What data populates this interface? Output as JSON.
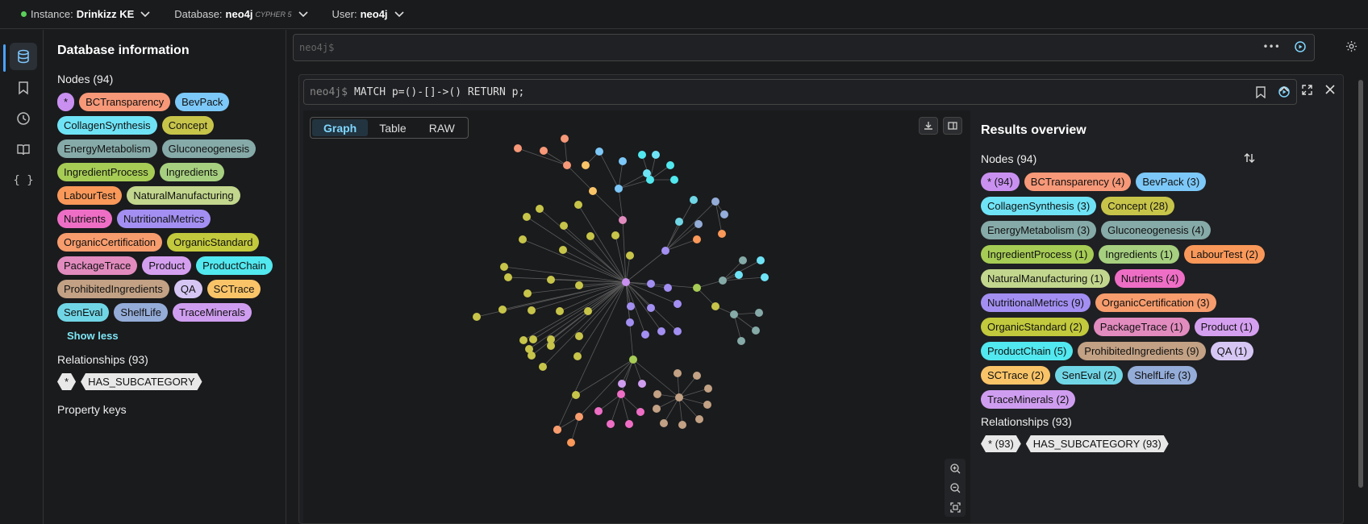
{
  "topbar": {
    "instance_label": "Instance:",
    "instance_value": "Drinkizz KE",
    "database_label": "Database:",
    "database_value": "neo4j",
    "database_tag": "CYPHER 5",
    "user_label": "User:",
    "user_value": "neo4j"
  },
  "sidebar": {
    "title": "Database information",
    "nodes_heading": "Nodes (94)",
    "show_less": "Show less",
    "relationships_heading": "Relationships (93)",
    "property_keys_heading": "Property keys",
    "labels": [
      {
        "text": "*",
        "color": "#c990f0"
      },
      {
        "text": "BCTransparency",
        "color": "#f79878"
      },
      {
        "text": "BevPack",
        "color": "#7cc8f8"
      },
      {
        "text": "CollagenSynthesis",
        "color": "#6fe3f6"
      },
      {
        "text": "Concept",
        "color": "#c7c44a"
      },
      {
        "text": "EnergyMetabolism",
        "color": "#85aaa8"
      },
      {
        "text": "Gluconeogenesis",
        "color": "#85aaa8"
      },
      {
        "text": "IngredientProcess",
        "color": "#a6cc55"
      },
      {
        "text": "Ingredients",
        "color": "#a6d07f"
      },
      {
        "text": "LabourTest",
        "color": "#f99859"
      },
      {
        "text": "NaturalManufacturing",
        "color": "#c2d68d"
      },
      {
        "text": "Nutrients",
        "color": "#ee6ec5"
      },
      {
        "text": "NutritionalMetrics",
        "color": "#a38ff2"
      },
      {
        "text": "OrganicCertification",
        "color": "#f79c6d"
      },
      {
        "text": "OrganicStandard",
        "color": "#c2c93c"
      },
      {
        "text": "PackageTrace",
        "color": "#e28bbf"
      },
      {
        "text": "Product",
        "color": "#d59ff0"
      },
      {
        "text": "ProductChain",
        "color": "#52e8ef"
      },
      {
        "text": "ProhibitedIngredients",
        "color": "#c2a184"
      },
      {
        "text": "QA",
        "color": "#d6c6f4"
      },
      {
        "text": "SCTrace",
        "color": "#f9c468"
      },
      {
        "text": "SenEval",
        "color": "#70d6e6"
      },
      {
        "text": "ShelfLife",
        "color": "#94acd8"
      },
      {
        "text": "TraceMinerals",
        "color": "#cf9df0"
      }
    ],
    "relationships": [
      "*",
      "HAS_SUBCATEGORY"
    ]
  },
  "editor": {
    "prompt": "neo4j$"
  },
  "frame": {
    "prompt": "neo4j$",
    "query": "MATCH p=()-[]->() RETURN p;"
  },
  "viz_tabs": [
    "Graph",
    "Table",
    "RAW"
  ],
  "results": {
    "title": "Results overview",
    "nodes_heading": "Nodes (94)",
    "relationships_heading": "Relationships (93)",
    "labels": [
      {
        "text": "* (94)",
        "color": "#c990f0"
      },
      {
        "text": "BCTransparency (4)",
        "color": "#f79878"
      },
      {
        "text": "BevPack (3)",
        "color": "#7cc8f8"
      },
      {
        "text": "CollagenSynthesis (3)",
        "color": "#6fe3f6"
      },
      {
        "text": "Concept (28)",
        "color": "#c7c44a"
      },
      {
        "text": "EnergyMetabolism (3)",
        "color": "#85aaa8"
      },
      {
        "text": "Gluconeogenesis (4)",
        "color": "#85aaa8"
      },
      {
        "text": "IngredientProcess (1)",
        "color": "#a6cc55"
      },
      {
        "text": "Ingredients (1)",
        "color": "#a6d07f"
      },
      {
        "text": "LabourTest (2)",
        "color": "#f99859"
      },
      {
        "text": "NaturalManufacturing (1)",
        "color": "#c2d68d"
      },
      {
        "text": "Nutrients (4)",
        "color": "#ee6ec5"
      },
      {
        "text": "NutritionalMetrics (9)",
        "color": "#a38ff2"
      },
      {
        "text": "OrganicCertification (3)",
        "color": "#f79c6d"
      },
      {
        "text": "OrganicStandard (2)",
        "color": "#c2c93c"
      },
      {
        "text": "PackageTrace (1)",
        "color": "#e28bbf"
      },
      {
        "text": "Product (1)",
        "color": "#d59ff0"
      },
      {
        "text": "ProductChain (5)",
        "color": "#52e8ef"
      },
      {
        "text": "ProhibitedIngredients (9)",
        "color": "#c2a184"
      },
      {
        "text": "QA (1)",
        "color": "#d6c6f4"
      },
      {
        "text": "SCTrace (2)",
        "color": "#f9c468"
      },
      {
        "text": "SenEval (2)",
        "color": "#70d6e6"
      },
      {
        "text": "ShelfLife (3)",
        "color": "#94acd8"
      },
      {
        "text": "TraceMinerals (2)",
        "color": "#cf9df0"
      }
    ],
    "relationships": [
      "* (93)",
      "HAS_SUBCATEGORY (93)"
    ]
  },
  "graph": {
    "node_count": 94,
    "relationship_count": 93
  }
}
